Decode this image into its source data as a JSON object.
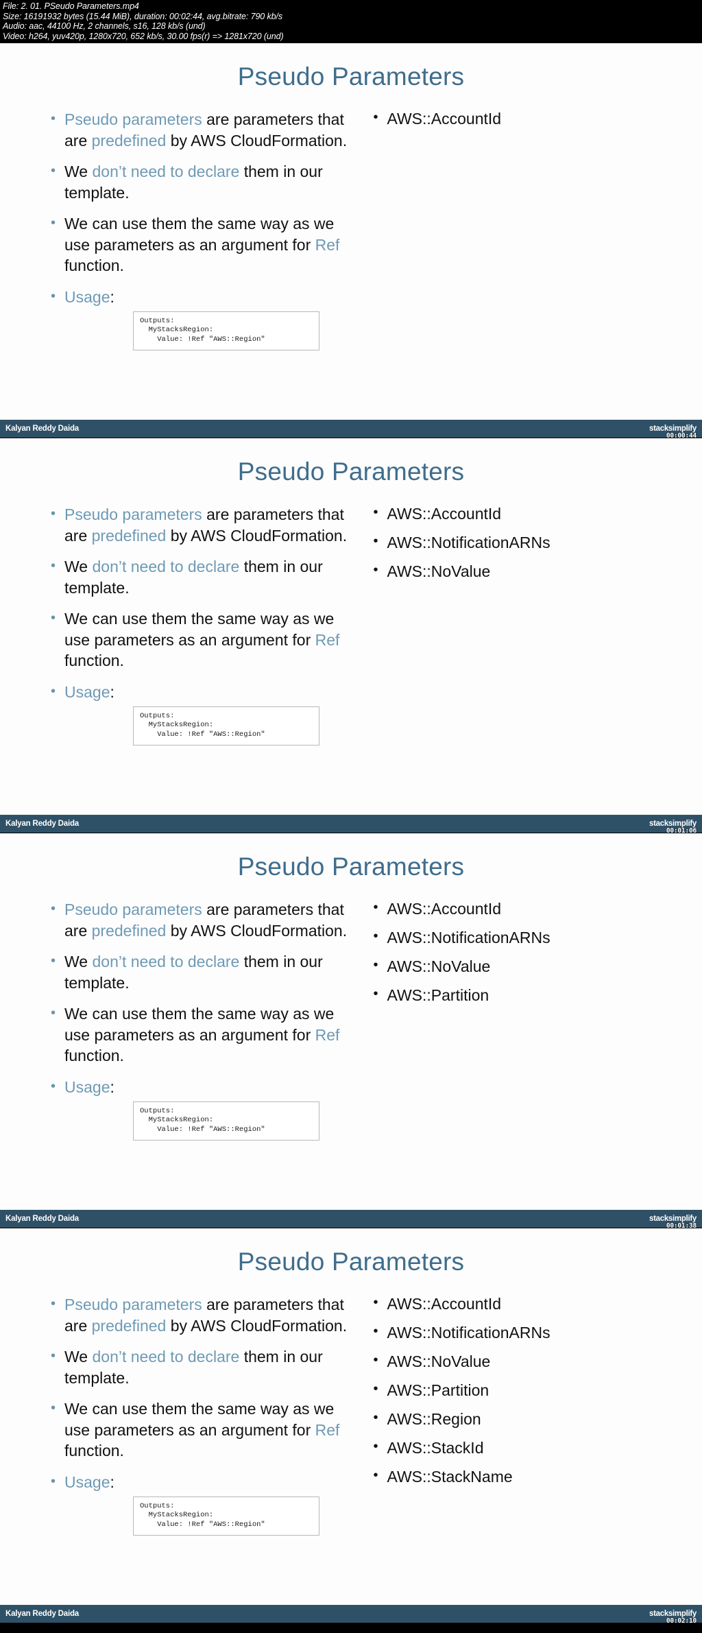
{
  "media_info": {
    "lines": [
      "File: 2. 01. PSeudo Parameters.mp4",
      "Size: 16191932 bytes (15.44 MiB), duration: 00:02:44, avg.bitrate: 790 kb/s",
      "Audio: aac, 44100 Hz, 2 channels, s16, 128 kb/s (und)",
      "Video: h264, yuv420p, 1280x720, 652 kb/s, 30.00 fps(r) => 1281x720 (und)"
    ]
  },
  "colors": {
    "title": "#3f6d8c",
    "highlight": "#6e9ab5",
    "footer_bar": "#2f5167",
    "slide_bg": "#fdfdfd"
  },
  "slide_common": {
    "title": "Pseudo Parameters",
    "bullets": [
      {
        "segments": [
          {
            "text": "Pseudo parameters ",
            "style": "highlight"
          },
          {
            "text": "are parameters that are ",
            "style": "normal"
          },
          {
            "text": "predefined ",
            "style": "highlight"
          },
          {
            "text": "by AWS CloudFormation.",
            "style": "normal"
          }
        ]
      },
      {
        "segments": [
          {
            "text": "We ",
            "style": "normal"
          },
          {
            "text": "don’t need to declare ",
            "style": "highlight"
          },
          {
            "text": "them in our template.",
            "style": "normal"
          }
        ]
      },
      {
        "segments": [
          {
            "text": "We can use them the same way as we use parameters as an argument for ",
            "style": "normal"
          },
          {
            "text": "Ref ",
            "style": "highlight"
          },
          {
            "text": "function.",
            "style": "normal"
          }
        ]
      }
    ],
    "usage_label": "Usage",
    "usage_colon": ":",
    "code_lines": [
      "Outputs:",
      "  MyStacksRegion:",
      "    Value: !Ref \"AWS::Region\""
    ],
    "footer_author": "Kalyan Reddy Daida",
    "footer_brand": "stacksimplify"
  },
  "slides": [
    {
      "index": 1,
      "aws_params": [
        "AWS::AccountId"
      ],
      "timestamp": "00:00:44"
    },
    {
      "index": 2,
      "aws_params": [
        "AWS::AccountId",
        "AWS::NotificationARNs",
        "AWS::NoValue"
      ],
      "timestamp": "00:01:06"
    },
    {
      "index": 3,
      "aws_params": [
        "AWS::AccountId",
        "AWS::NotificationARNs",
        "AWS::NoValue",
        "AWS::Partition"
      ],
      "timestamp": "00:01:38"
    },
    {
      "index": 4,
      "aws_params": [
        "AWS::AccountId",
        "AWS::NotificationARNs",
        "AWS::NoValue",
        "AWS::Partition",
        "AWS::Region",
        "AWS::StackId",
        "AWS::StackName"
      ],
      "timestamp": "00:02:10"
    }
  ]
}
